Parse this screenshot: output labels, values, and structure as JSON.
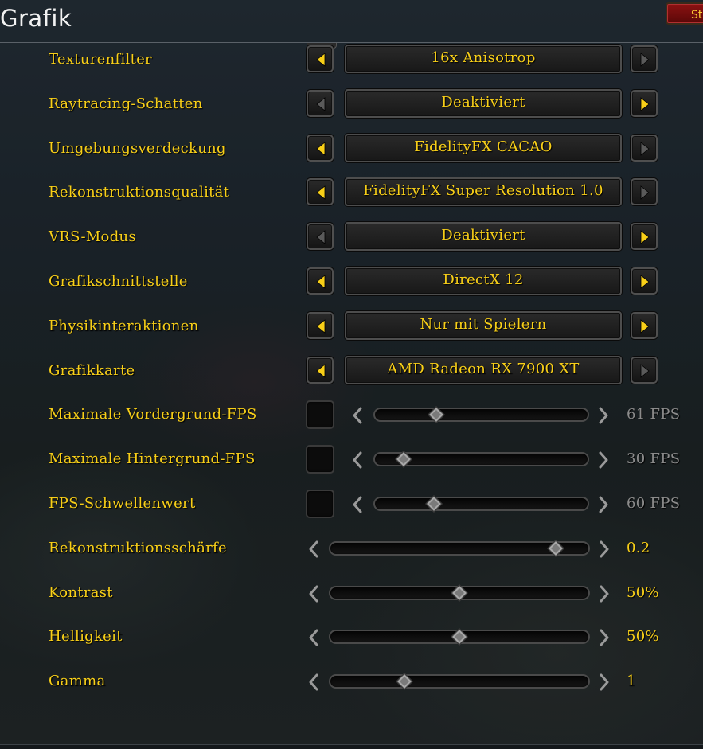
{
  "title": "Grafik",
  "top_button_label": "St",
  "colors": {
    "label_gold": "#f8cf18",
    "arrow_active": "#f8cf18",
    "arrow_disabled": "#5a5a5a",
    "dim_value": "#8b8b8b"
  },
  "dropdown_rows": [
    {
      "label": "Texturenfilter",
      "value": "16x Anisotrop",
      "left_enabled": true,
      "right_enabled": false
    },
    {
      "label": "Raytracing-Schatten",
      "value": "Deaktiviert",
      "left_enabled": false,
      "right_enabled": true
    },
    {
      "label": "Umgebungsverdeckung",
      "value": "FidelityFX CACAO",
      "left_enabled": true,
      "right_enabled": false
    },
    {
      "label": "Rekonstruktionsqualität",
      "value": "FidelityFX Super Resolution 1.0",
      "left_enabled": true,
      "right_enabled": false
    },
    {
      "label": "VRS-Modus",
      "value": "Deaktiviert",
      "left_enabled": false,
      "right_enabled": true
    },
    {
      "label": "Grafikschnittstelle",
      "value": "DirectX 12",
      "left_enabled": true,
      "right_enabled": true
    },
    {
      "label": "Physikinteraktionen",
      "value": "Nur mit Spielern",
      "left_enabled": true,
      "right_enabled": true
    },
    {
      "label": "Grafikkarte",
      "value": "AMD Radeon RX 7900 XT",
      "left_enabled": true,
      "right_enabled": false
    }
  ],
  "checkbox_slider_rows": [
    {
      "label": "Maximale Vordergrund-FPS",
      "value": "61 FPS",
      "checked": false,
      "level": 0.29
    },
    {
      "label": "Maximale Hintergrund-FPS",
      "value": "30 FPS",
      "checked": false,
      "level": 0.14
    },
    {
      "label": "FPS-Schwellenwert",
      "value": "60 FPS",
      "checked": false,
      "level": 0.28
    }
  ],
  "slider_rows": [
    {
      "label": "Rekonstruktionsschärfe",
      "value": "0.2",
      "level": 0.87
    },
    {
      "label": "Kontrast",
      "value": "50%",
      "level": 0.5
    },
    {
      "label": "Helligkeit",
      "value": "50%",
      "level": 0.5
    },
    {
      "label": "Gamma",
      "value": "1",
      "level": 0.29
    }
  ]
}
